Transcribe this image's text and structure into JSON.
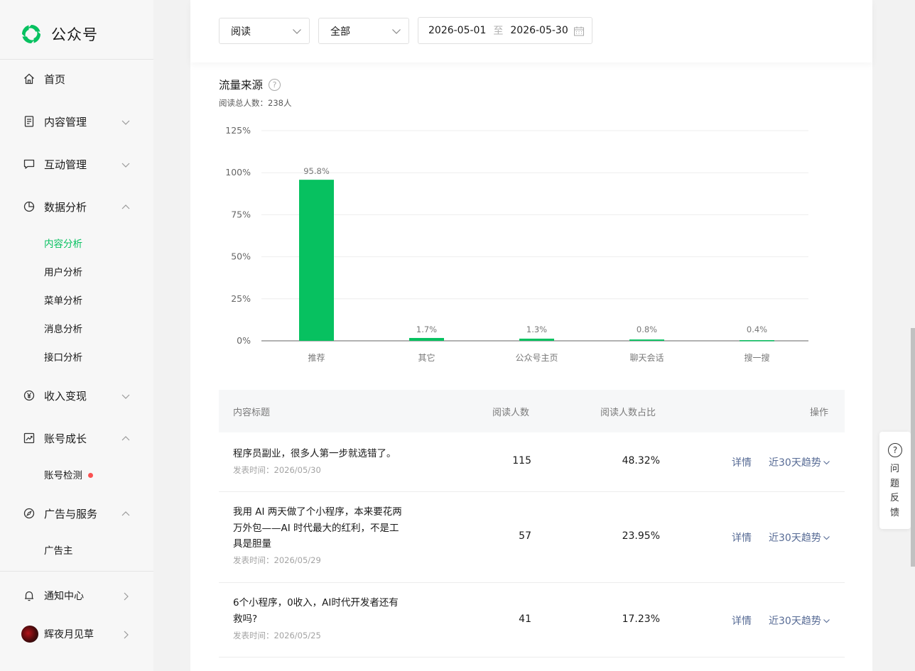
{
  "app": {
    "name": "公众号"
  },
  "sidebar": {
    "items": [
      {
        "label": "首页"
      },
      {
        "label": "内容管理"
      },
      {
        "label": "互动管理"
      },
      {
        "label": "数据分析"
      },
      {
        "label": "收入变现"
      },
      {
        "label": "账号成长"
      },
      {
        "label": "广告与服务"
      }
    ],
    "data_analysis_sub": [
      "内容分析",
      "用户分析",
      "菜单分析",
      "消息分析",
      "接口分析"
    ],
    "growth_sub": [
      "账号检测"
    ],
    "ads_sub": [
      "广告主"
    ],
    "notification": "通知中心",
    "user": "辉夜月见草"
  },
  "filters": {
    "metric": "阅读",
    "scope": "全部",
    "date_start": "2026-05-01",
    "date_sep": "至",
    "date_end": "2026-05-30"
  },
  "traffic": {
    "title": "流量来源",
    "help": "?",
    "subtitle": "阅读总人数：238人"
  },
  "chart_data": {
    "type": "bar",
    "categories": [
      "推荐",
      "其它",
      "公众号主页",
      "聊天会话",
      "搜一搜"
    ],
    "values": [
      95.8,
      1.7,
      1.3,
      0.8,
      0.4
    ],
    "value_labels": [
      "95.8%",
      "1.7%",
      "1.3%",
      "0.8%",
      "0.4%"
    ],
    "yticks": [
      "0%",
      "25%",
      "50%",
      "75%",
      "100%",
      "125%"
    ],
    "ylim": [
      0,
      125
    ],
    "grid": true,
    "color": "#07c160"
  },
  "table": {
    "headers": {
      "title": "内容标题",
      "readers": "阅读人数",
      "ratio": "阅读人数占比",
      "action": "操作"
    },
    "rows": [
      {
        "title": "程序员副业，很多人第一步就选错了。",
        "date": "发表时间：2026/05/30",
        "readers": "115",
        "ratio": "48.32%",
        "detail": "详情",
        "trend": "近30天趋势"
      },
      {
        "title": "我用 AI 两天做了个小程序，本来要花两万外包——AI 时代最大的红利，不是工具是胆量",
        "date": "发表时间：2026/05/29",
        "readers": "57",
        "ratio": "23.95%",
        "detail": "详情",
        "trend": "近30天趋势"
      },
      {
        "title": "6个小程序，0收入，AI时代开发者还有救吗?",
        "date": "发表时间：2026/05/25",
        "readers": "41",
        "ratio": "17.23%",
        "detail": "详情",
        "trend": "近30天趋势"
      }
    ]
  },
  "feedback": {
    "icon": "?",
    "label": "问题反馈"
  }
}
